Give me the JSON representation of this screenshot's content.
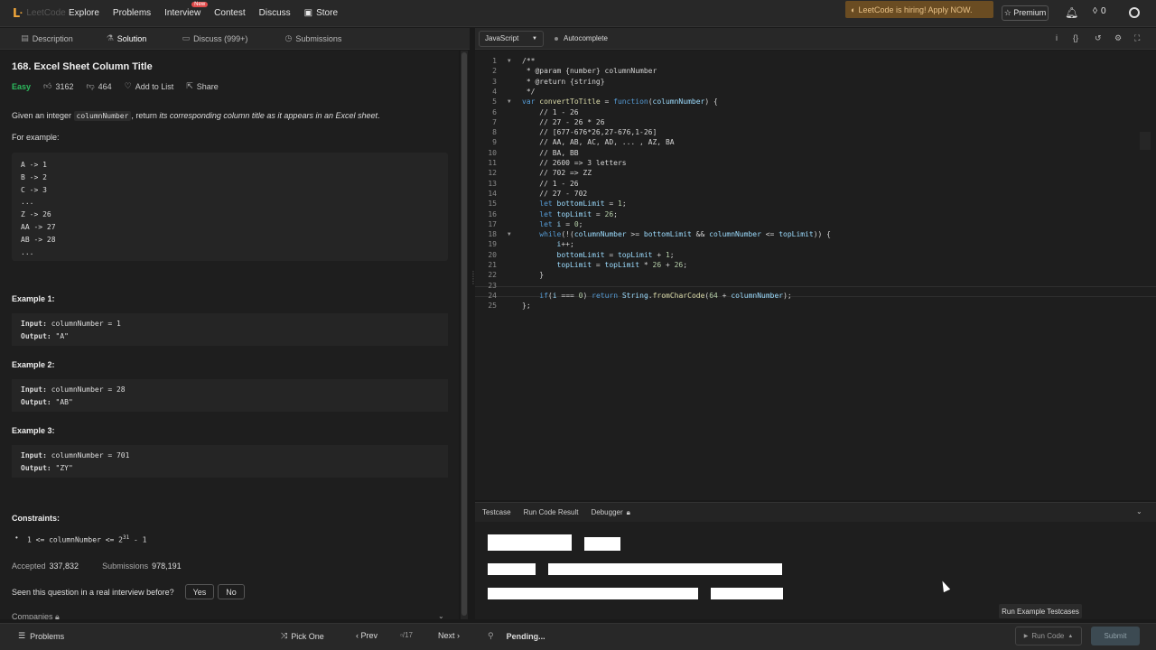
{
  "topnav": {
    "logo_text": "LeetCode",
    "items": [
      "Explore",
      "Problems",
      "Interview",
      "Contest",
      "Discuss"
    ],
    "new_badge": "New",
    "store": "Store",
    "hiring_banner": "LeetCode is hiring! Apply NOW.",
    "premium": "☆ Premium",
    "streak_count": "0"
  },
  "left_tabs": [
    {
      "label": "Description"
    },
    {
      "label": "Solution"
    },
    {
      "label": "Discuss (999+)"
    },
    {
      "label": "Submissions"
    }
  ],
  "problem": {
    "title": "168. Excel Sheet Column Title",
    "difficulty": "Easy",
    "likes": "3162",
    "dislikes": "464",
    "add_to_list": "Add to List",
    "share": "Share",
    "desc_prefix": "Given an integer ",
    "desc_code": "columnNumber",
    "desc_middle": ", return ",
    "desc_italic": "its corresponding column title as it appears in an Excel sheet",
    "desc_end": ".",
    "for_example": "For example:",
    "mapping_lines": [
      "A -> 1",
      "B -> 2",
      "C -> 3",
      "...",
      "Z -> 26",
      "AA -> 27",
      "AB -> 28",
      "..."
    ],
    "examples": [
      {
        "title": "Example 1:",
        "input_label": "Input:",
        "input": "columnNumber = 1",
        "output_label": "Output:",
        "output": "\"A\""
      },
      {
        "title": "Example 2:",
        "input_label": "Input:",
        "input": "columnNumber = 28",
        "output_label": "Output:",
        "output": "\"AB\""
      },
      {
        "title": "Example 3:",
        "input_label": "Input:",
        "input": "columnNumber = 701",
        "output_label": "Output:",
        "output": "\"ZY\""
      }
    ],
    "constraints_title": "Constraints:",
    "constraint_main": "1 <= columnNumber <= 2",
    "constraint_sup": "31",
    "constraint_tail": " - 1",
    "accepted_label": "Accepted",
    "accepted": "337,832",
    "submissions_label": "Submissions",
    "submissions": "978,191",
    "interview_q": "Seen this question in a real interview before?",
    "yes": "Yes",
    "no": "No",
    "companies": "Companies"
  },
  "editor": {
    "language": "JavaScript",
    "autocomplete": "Autocomplete"
  },
  "console": {
    "tabs": [
      "Testcase",
      "Run Code Result",
      "Debugger"
    ],
    "tooltip": "Run Example Testcases"
  },
  "bottom": {
    "problems": "Problems",
    "pick_one": "Pick One",
    "prev": "Prev",
    "page": "/17",
    "next": "Next",
    "pending": "Pending...",
    "run_code": "Run Code",
    "submit": "Submit"
  }
}
